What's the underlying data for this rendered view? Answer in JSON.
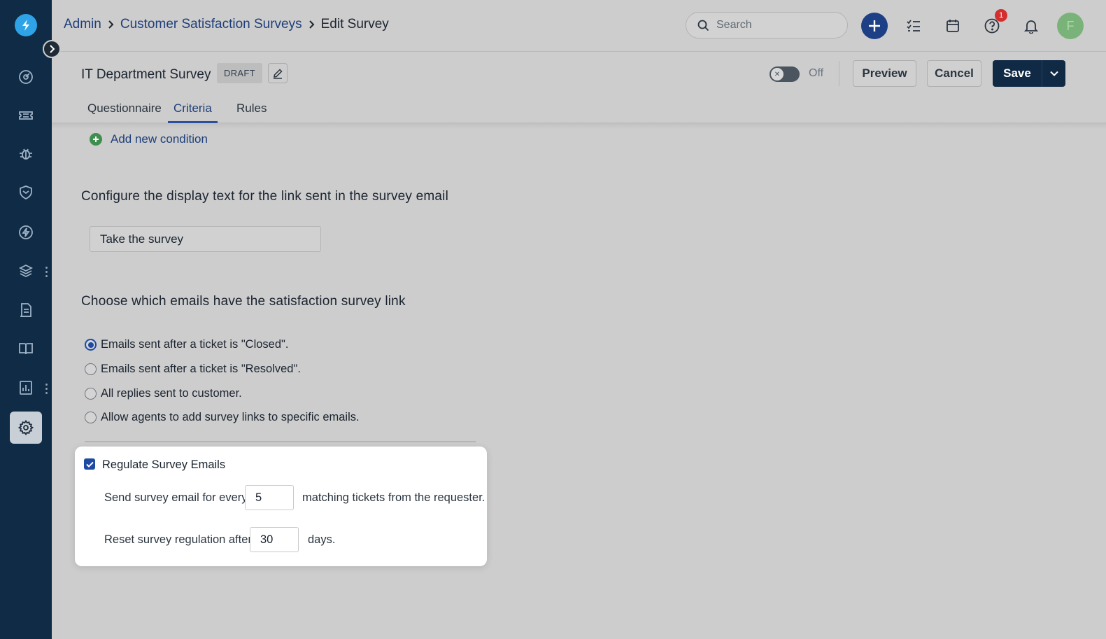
{
  "nav": {
    "logo": "freshservice-bolt-logo",
    "items": [
      {
        "icon": "dashboard-icon"
      },
      {
        "icon": "ticket-icon"
      },
      {
        "icon": "bug-icon"
      },
      {
        "icon": "shield-icon"
      },
      {
        "icon": "lightning-icon"
      },
      {
        "icon": "layers-icon"
      },
      {
        "icon": "document-icon"
      },
      {
        "icon": "book-icon"
      },
      {
        "icon": "analytics-icon"
      },
      {
        "icon": "gear-icon"
      }
    ]
  },
  "header": {
    "breadcrumb": [
      "Admin",
      "Customer Satisfaction Surveys",
      "Edit Survey"
    ],
    "search_placeholder": "Search",
    "notification_count": "1",
    "avatar_initial": "F"
  },
  "titlebar": {
    "survey_name": "IT Department Survey",
    "status_badge": "DRAFT",
    "toggle_state": "Off",
    "preview_label": "Preview",
    "cancel_label": "Cancel",
    "save_label": "Save"
  },
  "tabs": [
    "Questionnaire",
    "Criteria",
    "Rules"
  ],
  "active_tab": "Criteria",
  "content": {
    "add_condition": "Add new condition",
    "link_text_heading": "Configure the display text for the link sent in the survey email",
    "link_text_value": "Take the survey",
    "emails_heading": "Choose which emails have the satisfaction survey link",
    "email_options": [
      "Emails sent after a ticket is \"Closed\".",
      "Emails sent after a ticket is \"Resolved\".",
      "All replies sent to customer.",
      "Allow agents to add survey links to specific emails."
    ],
    "selected_option_index": 0
  },
  "regulate": {
    "label": "Regulate Survey Emails",
    "checked": true,
    "every_prefix": "Send survey email for every",
    "every_value": "5",
    "every_suffix": "matching tickets from the requester.",
    "reset_prefix": "Reset survey regulation after",
    "reset_value": "30",
    "reset_suffix": "days."
  },
  "colors": {
    "sidebar": "#0f2b46",
    "accent": "#1d3f86",
    "link": "#1f3f7a",
    "save_button": "#102a45",
    "badge_red": "#d32f2f"
  }
}
